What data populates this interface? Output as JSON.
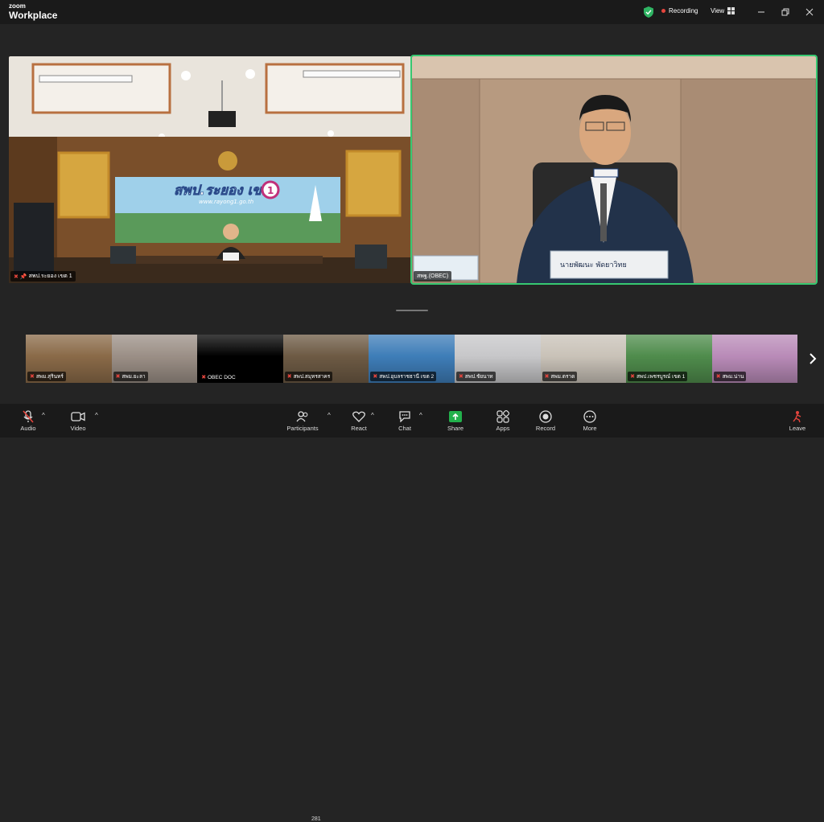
{
  "app": {
    "logo_small": "zoom",
    "logo_big": "Workplace"
  },
  "topbar": {
    "recording": "Recording",
    "view": "View"
  },
  "main_tiles": [
    {
      "name": "สพป.ระยอง เขต 1",
      "muted": true,
      "pinned": true
    },
    {
      "name": "สพฐ.(OBEC)",
      "muted": false,
      "active_speaker": true
    }
  ],
  "scene": {
    "banner_title": "สพป.ระยอง เขต",
    "banner_number": "1",
    "banner_url": "www.rayong1.go.th",
    "nameplate": "นายพัฒนะ พัดยาวิทย"
  },
  "thumbnails": [
    {
      "name": "สพม.สุรินทร์",
      "muted": true,
      "bg": "#8a6a48"
    },
    {
      "name": "สพม.ยะลา",
      "muted": true,
      "bg": "#9b8f86"
    },
    {
      "name": "OBEC DOC",
      "muted": true,
      "bg": "#000000"
    },
    {
      "name": "สพป.สมุทรสาคร",
      "muted": true,
      "bg": "#6d5a44"
    },
    {
      "name": "สพป.อุบลราชธานี เขต 2",
      "muted": true,
      "bg": "#3e7db8"
    },
    {
      "name": "สพป.ชัยนาท",
      "muted": true,
      "bg": "#c7c7c9"
    },
    {
      "name": "สพม.ตราด",
      "muted": true,
      "bg": "#c9c2b8"
    },
    {
      "name": "สพป.เพชรบูรณ์ เขต 1",
      "muted": true,
      "bg": "#4f8c4c"
    },
    {
      "name": "สพม.น่าน",
      "muted": true,
      "bg": "#b98bb8"
    }
  ],
  "toolbar": {
    "audio": "Audio",
    "video": "Video",
    "participants": "Participants",
    "participants_count": "281",
    "react": "React",
    "chat": "Chat",
    "share": "Share",
    "apps": "Apps",
    "record": "Record",
    "more": "More",
    "leave": "Leave"
  },
  "colors": {
    "active_border": "#37c871",
    "muted_red": "#e5453d",
    "share_green": "#22b14c"
  }
}
